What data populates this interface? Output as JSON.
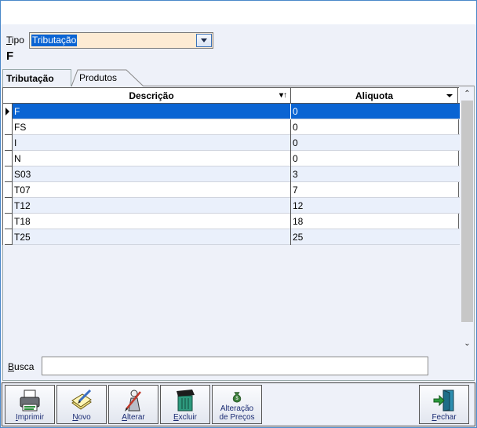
{
  "tipo": {
    "label_underlined": "T",
    "label_rest": "ipo",
    "value": "Tributação"
  },
  "current_code": "F",
  "tabs": [
    {
      "label": "Tributação"
    },
    {
      "label": "Produtos"
    }
  ],
  "grid": {
    "columns": [
      {
        "label": "Descrição"
      },
      {
        "label": "Aliquota"
      }
    ],
    "rows": [
      {
        "descricao": "F",
        "aliquota": "0"
      },
      {
        "descricao": "FS",
        "aliquota": "0"
      },
      {
        "descricao": "I",
        "aliquota": "0"
      },
      {
        "descricao": "N",
        "aliquota": "0"
      },
      {
        "descricao": "S03",
        "aliquota": "3"
      },
      {
        "descricao": "T07",
        "aliquota": "7"
      },
      {
        "descricao": "T12",
        "aliquota": "12"
      },
      {
        "descricao": "T18",
        "aliquota": "18"
      },
      {
        "descricao": "T25",
        "aliquota": "25"
      }
    ],
    "selected_row": 0
  },
  "busca": {
    "label_underlined": "B",
    "label_rest": "usca",
    "value": ""
  },
  "toolbar": {
    "imprimir": {
      "underlined": "I",
      "rest": "mprimir"
    },
    "novo": {
      "underlined": "N",
      "rest": "ovo"
    },
    "alterar": {
      "underlined": "A",
      "rest": "lterar"
    },
    "excluir": {
      "underlined": "E",
      "rest": "xcluir"
    },
    "alteracao_precos_line1": "Alteração",
    "alteracao_precos_line2": "de Preços",
    "fechar": {
      "underlined": "F",
      "rest": "echar"
    }
  },
  "colors": {
    "selection": "#0a64d3",
    "combo_bg": "#fdebd4",
    "label_text": "#1b2c74"
  }
}
